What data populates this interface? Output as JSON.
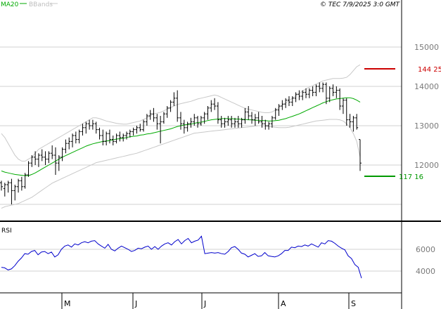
{
  "legend": {
    "ma_label": "MA20",
    "bb_label": "BBands",
    "ma_color": "#00aa00",
    "bb_color": "#c0c0c0"
  },
  "copyright": "© TEC 7/9/2025 3:0 GMT",
  "rsi_label": "RSI",
  "months": [
    "M",
    "J",
    "J",
    "A",
    "S"
  ],
  "price_axis": {
    "ticks": [
      "15000",
      "14000",
      "13000",
      "12000"
    ]
  },
  "rsi_axis": {
    "ticks": [
      "6000",
      "4000"
    ]
  },
  "targets": {
    "upper": {
      "label": "144 25",
      "color": "#cc0000"
    },
    "lower": {
      "label": "117 16",
      "color": "#009900"
    }
  },
  "chart_data": [
    {
      "type": "ohlc-bar",
      "note": "price panel: daily bars, MA20 (green), Bollinger Bands (grey)",
      "ylim": [
        10800,
        15700
      ],
      "grid": true,
      "x_months": [
        "M",
        "J",
        "J",
        "A",
        "S"
      ],
      "bars": [
        [
          11550,
          11600,
          11350,
          11450
        ],
        [
          11400,
          11550,
          11200,
          11500
        ],
        [
          11500,
          11600,
          11300,
          11550
        ],
        [
          11550,
          11650,
          11000,
          11350
        ],
        [
          11350,
          11500,
          11100,
          11450
        ],
        [
          11450,
          11650,
          11300,
          11600
        ],
        [
          11600,
          11700,
          11350,
          11450
        ],
        [
          11450,
          11800,
          11400,
          11750
        ],
        [
          11750,
          12100,
          11700,
          12050
        ],
        [
          12050,
          12250,
          11950,
          12200
        ],
        [
          12200,
          12350,
          12000,
          12150
        ],
        [
          12150,
          12300,
          11950,
          12250
        ],
        [
          12250,
          12400,
          12100,
          12200
        ],
        [
          12200,
          12350,
          12000,
          12150
        ],
        [
          12150,
          12350,
          12050,
          12300
        ],
        [
          12300,
          12500,
          12150,
          12250
        ],
        [
          12250,
          12450,
          11750,
          12050
        ],
        [
          12050,
          12250,
          11850,
          12200
        ],
        [
          12200,
          12450,
          12100,
          12400
        ],
        [
          12400,
          12650,
          12300,
          12550
        ],
        [
          12550,
          12700,
          12400,
          12600
        ],
        [
          12600,
          12800,
          12450,
          12750
        ],
        [
          12750,
          12850,
          12550,
          12650
        ],
        [
          12650,
          12900,
          12550,
          12850
        ],
        [
          12850,
          13050,
          12750,
          12950
        ],
        [
          12950,
          13100,
          12800,
          13050
        ],
        [
          13050,
          13150,
          12900,
          13000
        ],
        [
          13000,
          13150,
          12900,
          13050
        ],
        [
          13050,
          13100,
          12800,
          12900
        ],
        [
          12900,
          12950,
          12650,
          12750
        ],
        [
          12750,
          12900,
          12500,
          12600
        ],
        [
          12600,
          12850,
          12500,
          12800
        ],
        [
          12800,
          12900,
          12550,
          12650
        ],
        [
          12650,
          12750,
          12500,
          12600
        ],
        [
          12600,
          12800,
          12550,
          12750
        ],
        [
          12750,
          12850,
          12600,
          12700
        ],
        [
          12700,
          12800,
          12600,
          12750
        ],
        [
          12750,
          12850,
          12650,
          12800
        ],
        [
          12800,
          12900,
          12700,
          12850
        ],
        [
          12850,
          12950,
          12750,
          12900
        ],
        [
          12900,
          13000,
          12800,
          12950
        ],
        [
          12950,
          13050,
          12850,
          12900
        ],
        [
          12900,
          13150,
          12850,
          13100
        ],
        [
          13100,
          13300,
          13000,
          13250
        ],
        [
          13250,
          13400,
          13150,
          13300
        ],
        [
          13300,
          13450,
          13100,
          13200
        ],
        [
          13200,
          13300,
          12900,
          13050
        ],
        [
          13050,
          13250,
          12550,
          13100
        ],
        [
          13100,
          13350,
          13050,
          13300
        ],
        [
          13300,
          13500,
          13200,
          13450
        ],
        [
          13450,
          13650,
          13350,
          13600
        ],
        [
          13600,
          13850,
          13500,
          13700
        ],
        [
          13700,
          13900,
          13100,
          13200
        ],
        [
          13200,
          13350,
          12900,
          13050
        ],
        [
          13050,
          13150,
          12800,
          12950
        ],
        [
          12950,
          13100,
          12850,
          13050
        ],
        [
          13050,
          13200,
          12950,
          13100
        ],
        [
          13100,
          13300,
          13000,
          13200
        ],
        [
          13200,
          13250,
          12950,
          13050
        ],
        [
          13050,
          13250,
          13000,
          13200
        ],
        [
          13200,
          13350,
          13050,
          13300
        ],
        [
          13300,
          13500,
          13150,
          13450
        ],
        [
          13450,
          13650,
          13350,
          13550
        ],
        [
          13550,
          13700,
          13400,
          13500
        ],
        [
          13500,
          13600,
          13050,
          13150
        ],
        [
          13150,
          13250,
          12950,
          13050
        ],
        [
          13050,
          13200,
          12950,
          13100
        ],
        [
          13100,
          13250,
          13000,
          13150
        ],
        [
          13150,
          13250,
          12950,
          13050
        ],
        [
          13050,
          13200,
          12950,
          13100
        ],
        [
          13100,
          13250,
          12950,
          13050
        ],
        [
          13050,
          13200,
          12950,
          13150
        ],
        [
          13150,
          13450,
          13050,
          13350
        ],
        [
          13350,
          13500,
          13150,
          13250
        ],
        [
          13250,
          13350,
          13050,
          13150
        ],
        [
          13150,
          13300,
          13000,
          13200
        ],
        [
          13200,
          13350,
          13050,
          13100
        ],
        [
          13100,
          13250,
          12950,
          13050
        ],
        [
          13050,
          13150,
          12900,
          13000
        ],
        [
          13000,
          13100,
          12900,
          13050
        ],
        [
          13050,
          13250,
          12950,
          13200
        ],
        [
          13200,
          13450,
          13150,
          13400
        ],
        [
          13400,
          13550,
          13250,
          13500
        ],
        [
          13500,
          13650,
          13400,
          13550
        ],
        [
          13550,
          13700,
          13450,
          13650
        ],
        [
          13650,
          13750,
          13500,
          13600
        ],
        [
          13600,
          13750,
          13500,
          13700
        ],
        [
          13700,
          13850,
          13600,
          13800
        ],
        [
          13800,
          13900,
          13650,
          13750
        ],
        [
          13750,
          13900,
          13650,
          13850
        ],
        [
          13850,
          13950,
          13700,
          13800
        ],
        [
          13800,
          13950,
          13700,
          13900
        ],
        [
          13900,
          14000,
          13750,
          13850
        ],
        [
          13850,
          14050,
          13750,
          14000
        ],
        [
          14000,
          14100,
          13850,
          13950
        ],
        [
          13950,
          14100,
          13850,
          14050
        ],
        [
          14050,
          14100,
          13550,
          13700
        ],
        [
          13700,
          14000,
          13600,
          13950
        ],
        [
          13950,
          14050,
          13750,
          13850
        ],
        [
          13850,
          14000,
          13700,
          13900
        ],
        [
          13900,
          13950,
          13400,
          13500
        ],
        [
          13500,
          13700,
          13300,
          13650
        ],
        [
          13650,
          13700,
          13000,
          13150
        ],
        [
          13150,
          13300,
          12950,
          13100
        ],
        [
          13100,
          13250,
          12850,
          13200
        ],
        [
          13200,
          13300,
          12900,
          12950
        ],
        [
          12650,
          12650,
          11850,
          12050
        ]
      ],
      "ma20": [
        11850,
        11820,
        11800,
        11780,
        11760,
        11750,
        11740,
        11730,
        11730,
        11760,
        11800,
        11850,
        11900,
        11950,
        12000,
        12050,
        12100,
        12150,
        12200,
        12240,
        12280,
        12320,
        12360,
        12400,
        12440,
        12480,
        12510,
        12540,
        12560,
        12580,
        12600,
        12610,
        12620,
        12640,
        12660,
        12670,
        12680,
        12700,
        12720,
        12730,
        12740,
        12760,
        12770,
        12790,
        12800,
        12820,
        12840,
        12860,
        12880,
        12900,
        12920,
        12950,
        12980,
        13000,
        13020,
        13030,
        13040,
        13060,
        13080,
        13090,
        13110,
        13130,
        13150,
        13160,
        13170,
        13180,
        13180,
        13180,
        13180,
        13170,
        13170,
        13160,
        13160,
        13150,
        13150,
        13140,
        13140,
        13130,
        13130,
        13120,
        13120,
        13130,
        13140,
        13160,
        13180,
        13210,
        13240,
        13270,
        13300,
        13340,
        13380,
        13420,
        13460,
        13500,
        13540,
        13580,
        13610,
        13640,
        13660,
        13680,
        13690,
        13700,
        13710,
        13710,
        13690,
        13650,
        13600
      ],
      "bb_upper": [
        12800,
        12700,
        12550,
        12400,
        12250,
        12150,
        12100,
        12100,
        12150,
        12200,
        12300,
        12400,
        12450,
        12500,
        12550,
        12600,
        12650,
        12700,
        12750,
        12800,
        12850,
        12900,
        12950,
        13000,
        13050,
        13100,
        13150,
        13200,
        13200,
        13180,
        13150,
        13120,
        13100,
        13080,
        13060,
        13050,
        13040,
        13040,
        13060,
        13080,
        13100,
        13120,
        13160,
        13200,
        13250,
        13300,
        13320,
        13340,
        13380,
        13420,
        13460,
        13500,
        13540,
        13560,
        13580,
        13600,
        13620,
        13650,
        13680,
        13700,
        13720,
        13740,
        13760,
        13780,
        13760,
        13720,
        13680,
        13640,
        13600,
        13560,
        13520,
        13480,
        13440,
        13420,
        13400,
        13380,
        13360,
        13340,
        13330,
        13330,
        13350,
        13400,
        13460,
        13520,
        13580,
        13640,
        13700,
        13760,
        13820,
        13880,
        13940,
        13980,
        14020,
        14060,
        14100,
        14140,
        14160,
        14180,
        14200,
        14200,
        14200,
        14210,
        14230,
        14300,
        14400,
        14500,
        14550
      ],
      "bb_lower": [
        10900,
        10940,
        10960,
        10980,
        11000,
        11020,
        11060,
        11100,
        11140,
        11180,
        11240,
        11300,
        11360,
        11420,
        11480,
        11540,
        11580,
        11620,
        11660,
        11700,
        11740,
        11780,
        11820,
        11860,
        11900,
        11940,
        11980,
        12020,
        12060,
        12080,
        12100,
        12120,
        12140,
        12160,
        12180,
        12200,
        12220,
        12240,
        12260,
        12280,
        12300,
        12330,
        12360,
        12390,
        12420,
        12450,
        12480,
        12510,
        12540,
        12570,
        12600,
        12630,
        12660,
        12690,
        12720,
        12750,
        12780,
        12810,
        12820,
        12830,
        12840,
        12850,
        12860,
        12870,
        12880,
        12890,
        12900,
        12910,
        12920,
        12930,
        12940,
        12950,
        12960,
        12970,
        12980,
        12990,
        13000,
        13000,
        12990,
        12980,
        12970,
        12960,
        12950,
        12950,
        12950,
        12960,
        12980,
        13000,
        13020,
        13040,
        13060,
        13080,
        13100,
        13120,
        13130,
        13140,
        13150,
        13160,
        13160,
        13160,
        13150,
        13120,
        13050,
        12950,
        12800,
        12600,
        12200
      ]
    },
    {
      "type": "line",
      "name": "RSI",
      "ylim": [
        3000,
        7500
      ],
      "values": [
        4350,
        4300,
        4100,
        4200,
        4500,
        4900,
        5200,
        5600,
        5550,
        5800,
        5900,
        5500,
        5750,
        5800,
        5600,
        5750,
        5300,
        5500,
        6000,
        6300,
        6400,
        6200,
        6500,
        6400,
        6600,
        6700,
        6600,
        6750,
        6800,
        6500,
        6300,
        6100,
        6450,
        6000,
        5850,
        6100,
        6300,
        6150,
        6000,
        5800,
        5900,
        6100,
        6050,
        6200,
        6300,
        6000,
        6250,
        6000,
        6300,
        6500,
        6600,
        6400,
        6700,
        6900,
        6500,
        6800,
        7000,
        6600,
        6750,
        6850,
        7200,
        5600,
        5650,
        5700,
        5650,
        5700,
        5600,
        5550,
        5800,
        6150,
        6250,
        6000,
        5650,
        5550,
        5300,
        5450,
        5600,
        5350,
        5400,
        5700,
        5400,
        5350,
        5300,
        5400,
        5600,
        5900,
        5900,
        6200,
        6150,
        6300,
        6250,
        6400,
        6300,
        6500,
        6350,
        6200,
        6600,
        6500,
        6800,
        6750,
        6550,
        6300,
        6100,
        5950,
        5400,
        5150,
        4600,
        4350,
        3350
      ]
    }
  ]
}
